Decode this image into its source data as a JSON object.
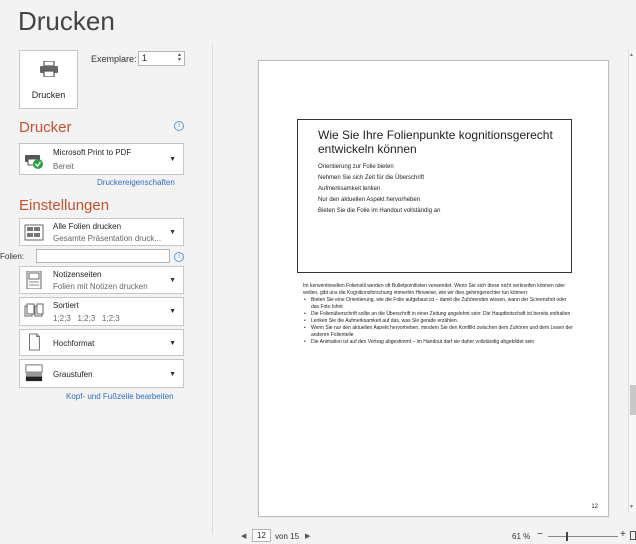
{
  "title": "Drucken",
  "print_button": {
    "label": "Drucken",
    "icon": "printer-icon"
  },
  "copies": {
    "label": "Exemplare:",
    "value": "1"
  },
  "printer": {
    "heading": "Drucker",
    "name": "Microsoft Print to PDF",
    "status": "Bereit",
    "properties_link": "Druckereigenschaften"
  },
  "settings": {
    "heading": "Einstellungen",
    "slides": {
      "title": "Alle Folien drucken",
      "subtitle": "Gesamte Präsentation druck..."
    },
    "folien_label": "Folien:",
    "folien_value": "",
    "layout": {
      "title": "Notizenseiten",
      "subtitle": "Folien mit Notizen drucken"
    },
    "collate": {
      "title": "Sortiert",
      "subtitle": "1;2;3   1;2;3   1;2;3"
    },
    "orientation": {
      "title": "Hochformat"
    },
    "color": {
      "title": "Graustufen"
    },
    "header_footer_link": "Kopf- und Fußzeile bearbeiten"
  },
  "preview": {
    "slide_title": "Wie Sie Ihre Folienpunkte kognitionsgerecht entwickeln können",
    "slide_bullets": [
      "Orientierung zur Folie bieten",
      "Nehmen Sie sich Zeit für die Überschrift",
      "Aufmerksamkeit lenken",
      "Nur den aktuellen Aspekt hervorheben",
      "Bieten Sie die Folie im Handout vollständig an"
    ],
    "notes_intro": "Im konventionellen Folienstil werden oft Bulletpointlisten verwendet. Wenn Sie sich diese nicht verkneifen können oder wollen, gibt uns die Kognitionsforschung immerhin Hinweise, wie wir dies gehimgerechter tun können:",
    "notes_bullets": [
      "Bieten Sie eine Orientierung, wie die Folie aufgebaut ist – damit die Zuhörenden wissen, wann der Screenshot oder das Foto lohnt",
      "Die Folienüberschrift sollte an die Überschrift in einer Zeitung angelehnt sein: Die Hauptbotschaft ist bereits enthalten",
      "Lenken Sie die Aufmerksamkeit auf das, was Sie gerade erzählen.",
      "Wenn Sie nur den aktuellen Aspekt hervorheben, mindern Sie den Konflikt zwischen dem Zuhören und dem Lesen der anderen Folienteile",
      "Die Animation ist auf den Vortrag abgestimmt – im Handout darf sie daher vollständig abgebildet sein"
    ],
    "page_number": "12"
  },
  "navigation": {
    "current_page": "12",
    "of_label": "von 15"
  },
  "zoom": {
    "percent_label": "61 %",
    "minus": "−",
    "plus": "+",
    "level_percent": 61
  },
  "colors": {
    "accent": "#c65230",
    "link": "#2e6ec1",
    "ready_green": "#2ea043"
  }
}
